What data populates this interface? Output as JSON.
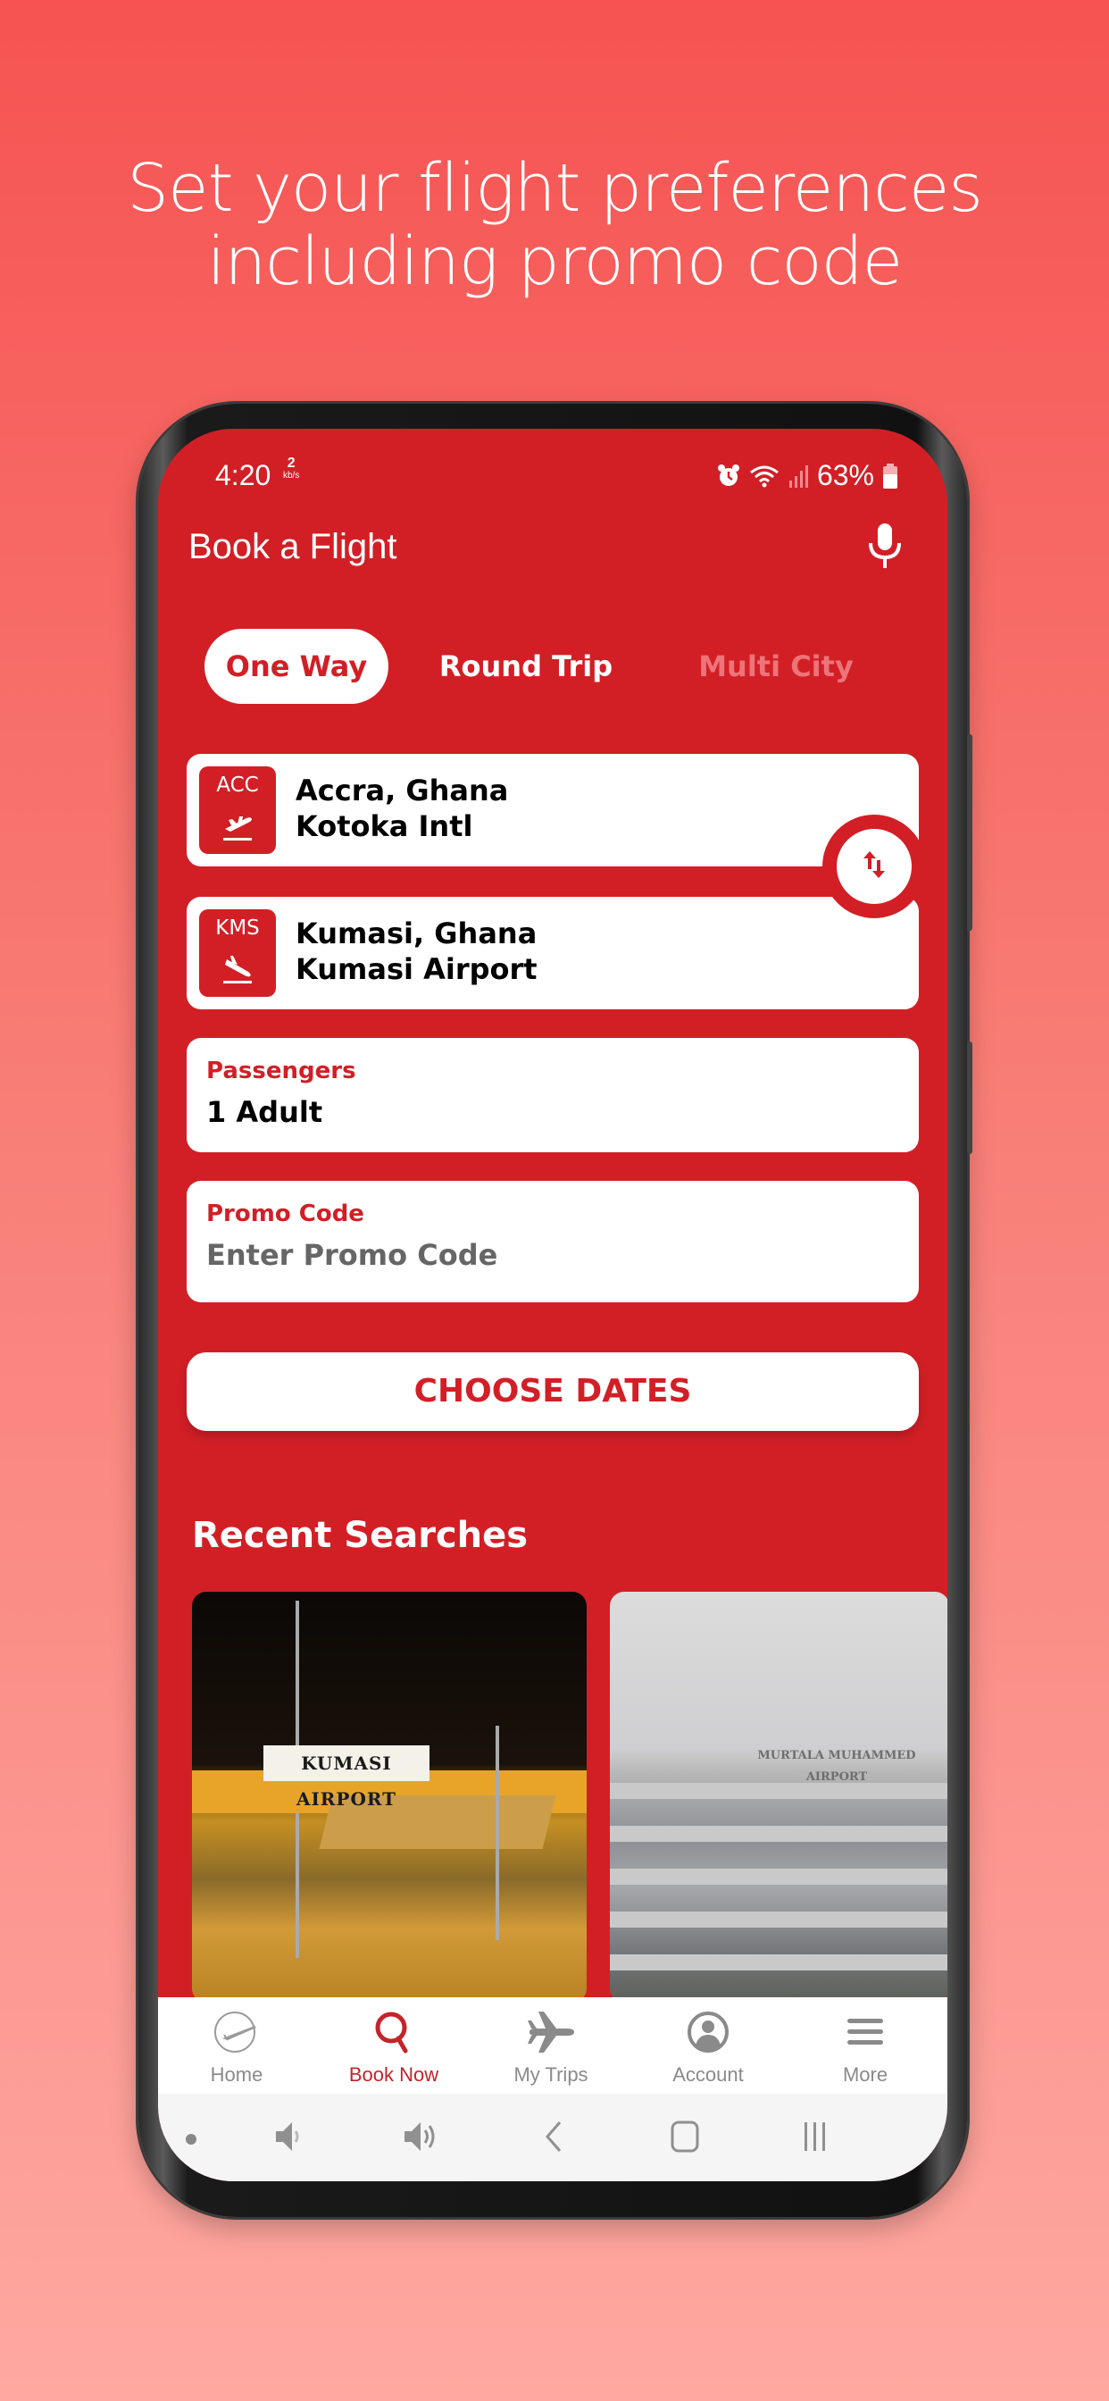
{
  "headline": {
    "line1": "Set your flight preferences",
    "line2": "including promo code"
  },
  "status_bar": {
    "time": "4:20",
    "net_speed_value": "2",
    "net_speed_unit": "kb/s",
    "battery": "63%",
    "icons": [
      "alarm-icon",
      "wifi-icon",
      "signal-icon",
      "battery-icon"
    ]
  },
  "app_bar": {
    "title": "Book a Flight",
    "action_icon": "mic-icon"
  },
  "trip_type": {
    "tabs": [
      {
        "label": "One Way",
        "state": "selected"
      },
      {
        "label": "Round Trip",
        "state": "enabled"
      },
      {
        "label": "Multi City",
        "state": "disabled"
      }
    ]
  },
  "origin": {
    "code": "ACC",
    "city": "Accra, Ghana",
    "airport": "Kotoka Intl",
    "icon": "takeoff-icon"
  },
  "destination": {
    "code": "KMS",
    "city": "Kumasi, Ghana",
    "airport": "Kumasi Airport",
    "icon": "landing-icon"
  },
  "swap_button": {
    "icon": "swap-vertical-icon"
  },
  "passengers": {
    "label": "Passengers",
    "value": "1 Adult"
  },
  "promo_code": {
    "label": "Promo Code",
    "value": "",
    "placeholder": "Enter Promo Code"
  },
  "choose_dates_label": "CHOOSE DATES",
  "recent_searches": {
    "title": "Recent Searches",
    "cards": [
      {
        "sign_text": "KUMASI AIRPORT"
      },
      {
        "sign_text": "MURTALA MUHAMMED AIRPORT"
      }
    ]
  },
  "bottom_nav": {
    "items": [
      {
        "label": "Home",
        "icon": "home-logo-icon",
        "active": false
      },
      {
        "label": "Book Now",
        "icon": "search-icon",
        "active": true
      },
      {
        "label": "My Trips",
        "icon": "airplane-icon",
        "active": false
      },
      {
        "label": "Account",
        "icon": "account-icon",
        "active": false
      },
      {
        "label": "More",
        "icon": "menu-icon",
        "active": false
      }
    ]
  },
  "system_nav": {
    "buttons": [
      "dot-icon",
      "volume-down-icon",
      "volume-up-icon",
      "back-icon",
      "home-icon",
      "recents-icon"
    ]
  },
  "colors": {
    "brand_red": "#d21f26",
    "inactive_gray": "#8a8a8a",
    "disabled_tab": "#ed7479",
    "background_top": "#f65352",
    "background_bottom": "#fea8a1"
  }
}
